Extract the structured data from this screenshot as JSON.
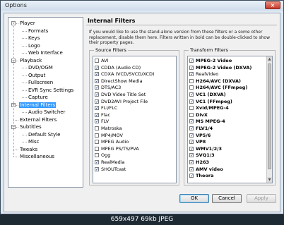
{
  "window": {
    "title": "Options",
    "close_glyph": "×"
  },
  "tree": [
    {
      "label": "Player",
      "expander": "−"
    },
    {
      "label": "Formats"
    },
    {
      "label": "Keys"
    },
    {
      "label": "Logo"
    },
    {
      "label": "Web Interface"
    },
    {
      "label": "Playback",
      "expander": "−"
    },
    {
      "label": "DVD/OGM"
    },
    {
      "label": "Output"
    },
    {
      "label": "Fullscreen"
    },
    {
      "label": "EVR Sync Settings"
    },
    {
      "label": "Capture"
    },
    {
      "label": "Internal Filters",
      "expander": "−",
      "selected": true
    },
    {
      "label": "Audio Switcher"
    },
    {
      "label": "External Filters"
    },
    {
      "label": "Subtitles",
      "expander": "−"
    },
    {
      "label": "Default Style"
    },
    {
      "label": "Misc"
    },
    {
      "label": "Tweaks"
    },
    {
      "label": "Miscellaneous"
    }
  ],
  "panel": {
    "title": "Internal Filters",
    "description": "If you would like to use the stand-alone version from these filters or a some other replacement, disable them here. Filters written in bold can be double-clicked to show their property pages."
  },
  "source_filters": {
    "label": "Source Filters",
    "items": [
      {
        "label": "AVI",
        "checked": false,
        "bold": false
      },
      {
        "label": "CDDA (Audio CD)",
        "checked": true,
        "bold": false
      },
      {
        "label": "CDXA (VCD/SVCD/XCD)",
        "checked": true,
        "bold": false
      },
      {
        "label": "DirectShow Media",
        "checked": true,
        "bold": false
      },
      {
        "label": "DTS/AC3",
        "checked": true,
        "bold": false
      },
      {
        "label": "DVD Video Title Set",
        "checked": true,
        "bold": false
      },
      {
        "label": "DVD2AVI Project File",
        "checked": true,
        "bold": false
      },
      {
        "label": "FLI/FLC",
        "checked": true,
        "bold": false
      },
      {
        "label": "Flac",
        "checked": true,
        "bold": false
      },
      {
        "label": "FLV",
        "checked": true,
        "bold": false
      },
      {
        "label": "Matroska",
        "checked": false,
        "bold": false
      },
      {
        "label": "MP4/MOV",
        "checked": false,
        "bold": false
      },
      {
        "label": "MPEG Audio",
        "checked": false,
        "bold": false
      },
      {
        "label": "MPEG PS/TS/PVA",
        "checked": false,
        "bold": false
      },
      {
        "label": "Ogg",
        "checked": false,
        "bold": false
      },
      {
        "label": "RealMedia",
        "checked": true,
        "bold": false
      },
      {
        "label": "SHOUTcast",
        "checked": true,
        "bold": false
      }
    ]
  },
  "transform_filters": {
    "label": "Transform Filters",
    "items": [
      {
        "label": "MPEG-2 Video",
        "checked": true,
        "bold": true
      },
      {
        "label": "MPEG-2 Video (DXVA)",
        "checked": true,
        "bold": true
      },
      {
        "label": "RealVideo",
        "checked": true,
        "bold": false
      },
      {
        "label": "H264/AVC (DXVA)",
        "checked": false,
        "bold": true
      },
      {
        "label": "H264/AVC (FFmpeg)",
        "checked": false,
        "bold": true
      },
      {
        "label": "VC1 (DXVA)",
        "checked": true,
        "bold": true
      },
      {
        "label": "VC1 (FFmpeg)",
        "checked": true,
        "bold": true
      },
      {
        "label": "Xvid/MPEG-4",
        "checked": false,
        "bold": true
      },
      {
        "label": "DivX",
        "checked": false,
        "bold": true
      },
      {
        "label": "MS MPEG-4",
        "checked": true,
        "bold": true
      },
      {
        "label": "FLV1/4",
        "checked": true,
        "bold": true
      },
      {
        "label": "VP5/6",
        "checked": true,
        "bold": true
      },
      {
        "label": "VP8",
        "checked": true,
        "bold": true
      },
      {
        "label": "WMV1/2/3",
        "checked": true,
        "bold": true
      },
      {
        "label": "SVQ1/3",
        "checked": true,
        "bold": true
      },
      {
        "label": "H263",
        "checked": true,
        "bold": true
      },
      {
        "label": "AMV video",
        "checked": true,
        "bold": true
      },
      {
        "label": "Theora",
        "checked": true,
        "bold": true
      }
    ]
  },
  "buttons": {
    "ok": "OK",
    "cancel": "Cancel",
    "apply": "Apply"
  },
  "caption": "659x497 69kb JPEG",
  "colors": {
    "selection": "#3399ff",
    "window_frame": "#dfe9f4",
    "close_button": "#c8392a"
  }
}
